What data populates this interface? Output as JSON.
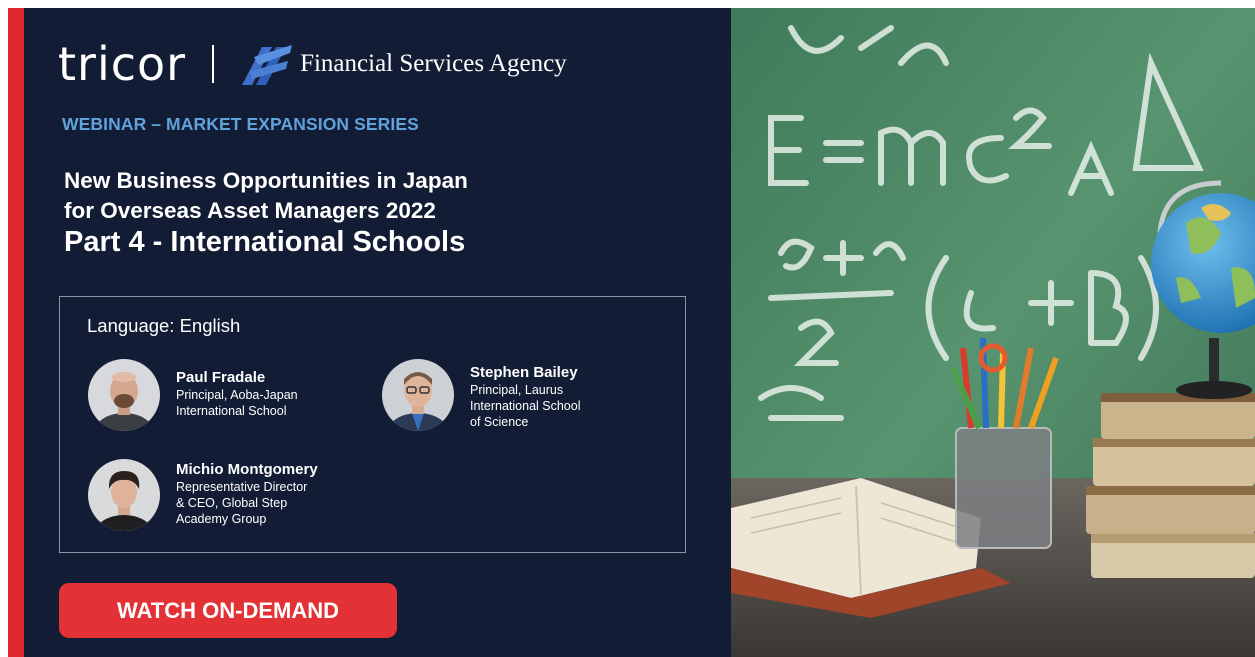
{
  "brand": {
    "logo_text": "tricor",
    "partner_name": "Financial Services Agency",
    "partner_icon": "fsa-logo-icon"
  },
  "webinar": {
    "series": "WEBINAR – MARKET EXPANSION SERIES",
    "title_line1": "New Business Opportunities in Japan",
    "title_line2": "for Overseas Asset Managers 2022",
    "title_line3": "Part 4 - International Schools"
  },
  "speakers_box": {
    "language": "Language: English",
    "speakers": [
      {
        "name": "Paul Fradale",
        "role_lines": [
          "Principal, Aoba-Japan",
          "International School"
        ]
      },
      {
        "name": "Stephen Bailey",
        "role_lines": [
          "Principal, Laurus",
          "International School",
          "of Science"
        ]
      },
      {
        "name": "Michio Montgomery",
        "role_lines": [
          "Representative Director",
          "& CEO, Global Step",
          "Academy Group"
        ]
      }
    ]
  },
  "cta": {
    "label": "WATCH ON-DEMAND"
  },
  "colors": {
    "panel_bg": "#121c35",
    "accent_red": "#e0272f",
    "series_blue": "#5ea3dc",
    "button_red": "#e33236",
    "chalkboard_green": "#4f8a67"
  }
}
